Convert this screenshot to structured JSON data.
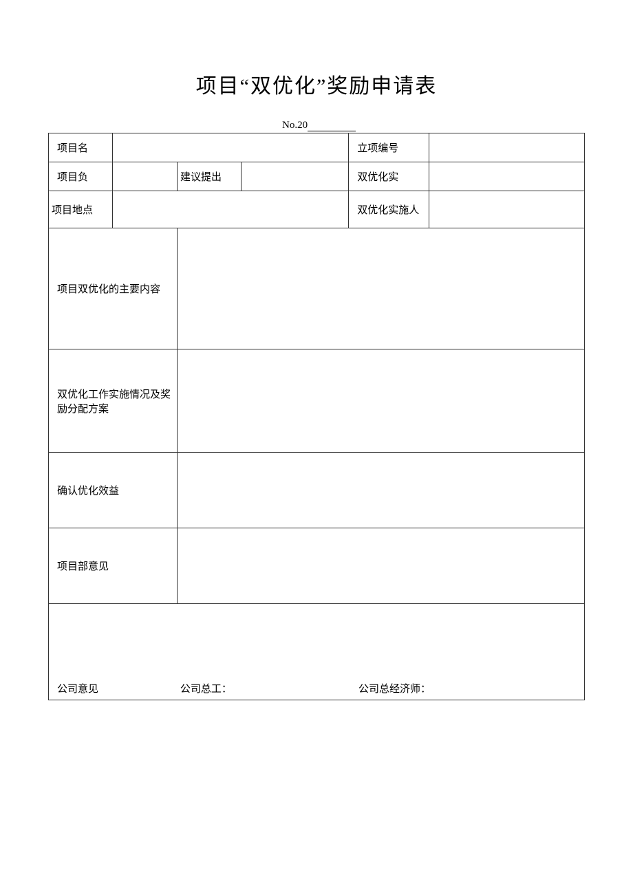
{
  "title": "项目“双优化”奖励申请表",
  "form_no_prefix": "No.20",
  "labels": {
    "project_name": "项目名",
    "project_no": "立项编号",
    "project_owner": "项目负",
    "suggestion": "建议提出",
    "dual_opt_impl": "双优化实",
    "project_location": "项目地点",
    "dual_opt_person": "双优化实施人",
    "main_content": "项目双优化的主要内容",
    "impl_reward": "双优化工作实施情况及奖励分配方案",
    "confirm_benefit": "确认优化效益",
    "project_dept_opinion": "项目部意见",
    "company_opinion": "公司意见",
    "chief_engineer": "公司总工：",
    "chief_economist": "公司总经济师："
  }
}
